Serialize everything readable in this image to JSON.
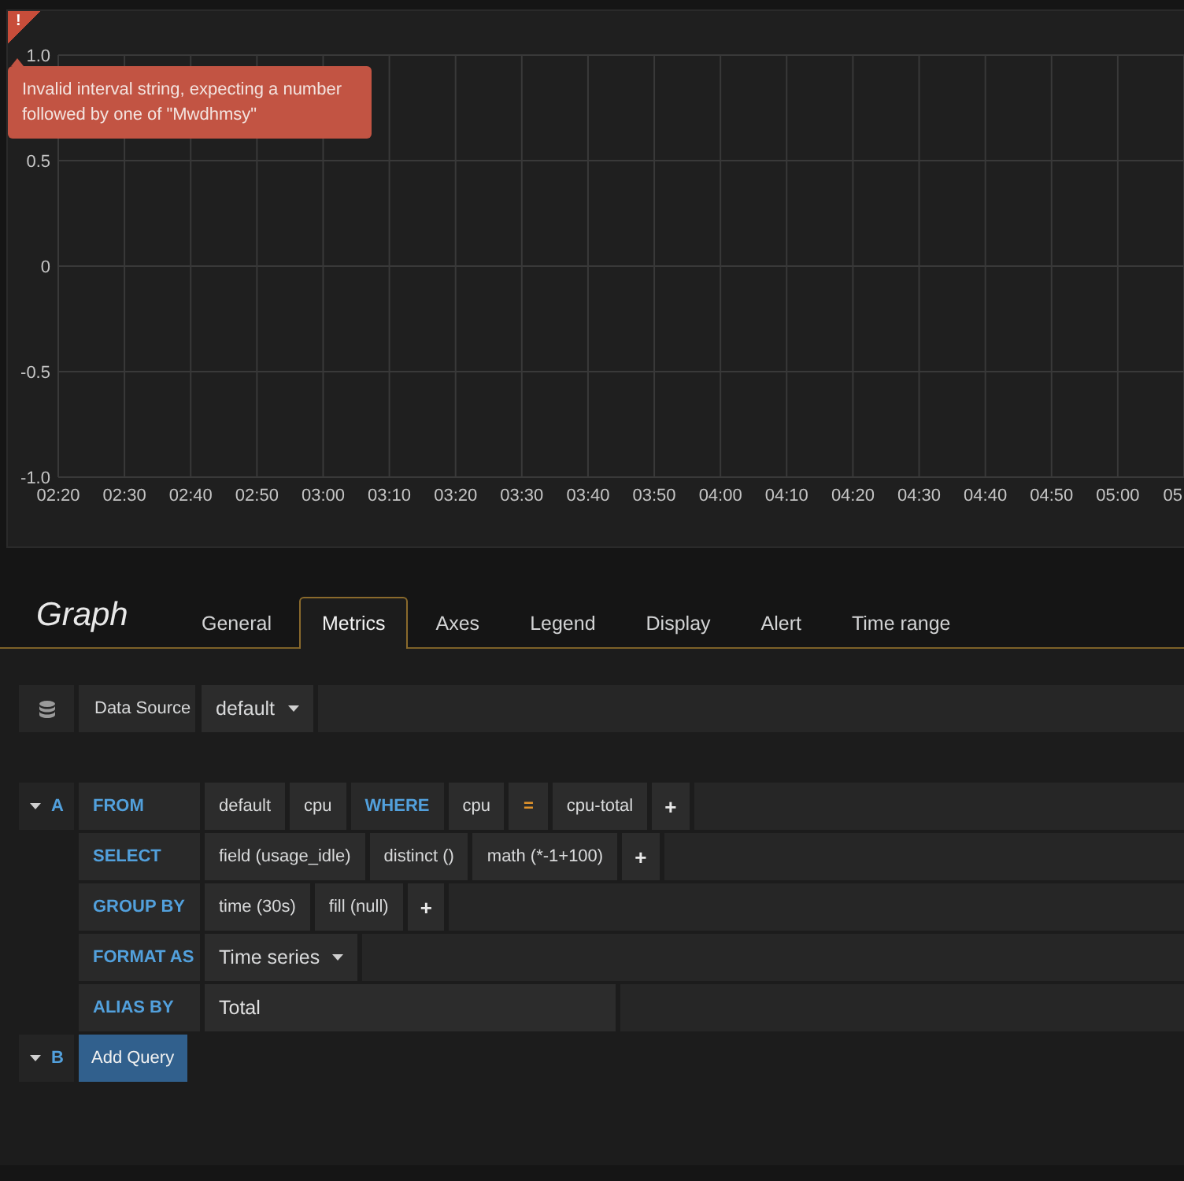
{
  "panel": {
    "error": {
      "icon": "!",
      "message": "Invalid interval string, expecting a number followed by one of \"Mwdhmsy\""
    },
    "chart_data": {
      "type": "line",
      "grid": true,
      "categories": [
        "02:20",
        "02:30",
        "02:40",
        "02:50",
        "03:00",
        "03:10",
        "03:20",
        "03:30",
        "03:40",
        "03:50",
        "04:00",
        "04:10",
        "04:20",
        "04:30",
        "04:40",
        "04:50",
        "05:00",
        "05"
      ],
      "ylim": [
        -1,
        1
      ],
      "yticks": [
        {
          "value": 1,
          "label": "1.0"
        },
        0.5,
        0,
        -0.5,
        {
          "value": -1,
          "label": "-1.0"
        }
      ]
    }
  },
  "editor": {
    "title": "Graph",
    "tabs": [
      {
        "label": "General",
        "selected": false
      },
      {
        "label": "Metrics",
        "selected": true
      },
      {
        "label": "Axes",
        "selected": false
      },
      {
        "label": "Legend",
        "selected": false
      },
      {
        "label": "Display",
        "selected": false
      },
      {
        "label": "Alert",
        "selected": false
      },
      {
        "label": "Time range",
        "selected": false
      }
    ]
  },
  "datasource": {
    "label": "Data Source",
    "value": "default"
  },
  "queries": [
    {
      "kind": "query",
      "letter": "A",
      "expanded": true,
      "rows": [
        {
          "keyword": "FROM",
          "segments": [
            {
              "kind": "value",
              "text": "default"
            },
            {
              "kind": "value",
              "text": "cpu"
            },
            {
              "kind": "keyword",
              "text": "WHERE"
            },
            {
              "kind": "value",
              "text": "cpu"
            },
            {
              "kind": "operator",
              "text": "="
            },
            {
              "kind": "value",
              "text": "cpu-total"
            },
            {
              "kind": "plus",
              "text": "+"
            }
          ]
        },
        {
          "keyword": "SELECT",
          "segments": [
            {
              "kind": "value",
              "text": "field (usage_idle)"
            },
            {
              "kind": "value",
              "text": "distinct ()"
            },
            {
              "kind": "value",
              "text": "math (*-1+100)"
            },
            {
              "kind": "plus",
              "text": "+"
            }
          ]
        },
        {
          "keyword": "GROUP BY",
          "segments": [
            {
              "kind": "value",
              "text": "time (30s)"
            },
            {
              "kind": "value",
              "text": "fill (null)"
            },
            {
              "kind": "plus",
              "text": "+"
            }
          ]
        },
        {
          "keyword": "FORMAT AS",
          "segments": [
            {
              "kind": "dropdown",
              "text": "Time series"
            }
          ]
        },
        {
          "keyword": "ALIAS BY",
          "segments": [
            {
              "kind": "input",
              "text": "Total"
            }
          ]
        }
      ]
    },
    {
      "kind": "add",
      "letter": "B",
      "expanded": true,
      "button": "Add Query"
    }
  ]
}
